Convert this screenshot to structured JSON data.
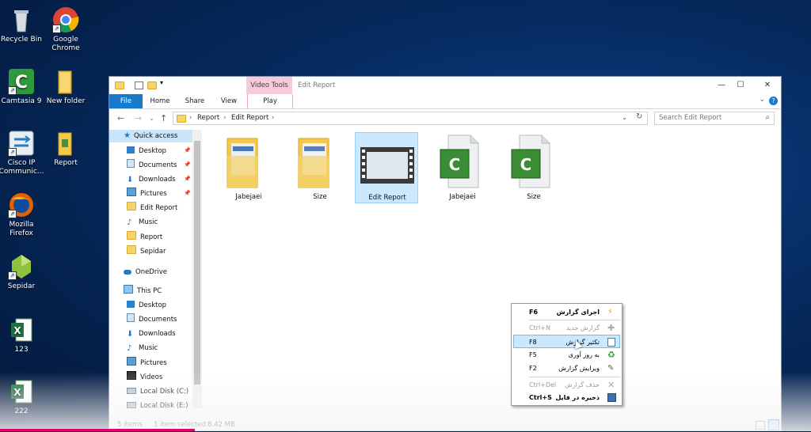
{
  "desktop": {
    "icons": [
      {
        "label": "Recycle Bin",
        "icon": "recycle-bin-icon"
      },
      {
        "label": "Google Chrome",
        "icon": "chrome-icon"
      },
      {
        "label": "Camtasia 9",
        "icon": "camtasia-icon"
      },
      {
        "label": "New folder",
        "icon": "folder-icon"
      },
      {
        "label": "Cisco IP Communic...",
        "icon": "cisco-ip-communicator-icon"
      },
      {
        "label": "Report",
        "icon": "file-icon"
      },
      {
        "label": "Mozilla Firefox",
        "icon": "firefox-icon"
      },
      {
        "label": "Sepidar",
        "icon": "sepidar-icon"
      },
      {
        "label": "123",
        "icon": "excel-icon"
      },
      {
        "label": "222",
        "icon": "excel-icon"
      }
    ]
  },
  "window": {
    "title": "Edit Report",
    "context_tab": "Video Tools",
    "ribbon_tabs": [
      "File",
      "Home",
      "Share",
      "View",
      "Play"
    ],
    "address": {
      "crumbs": [
        "Report",
        "Edit Report"
      ]
    },
    "search_placeholder": "Search Edit Report",
    "nav": {
      "quick_access": "Quick access",
      "quick_items": [
        "Desktop",
        "Documents",
        "Downloads",
        "Pictures",
        "Edit Report",
        "Music",
        "Report",
        "Sepidar"
      ],
      "onedrive": "OneDrive",
      "this_pc": "This PC",
      "pc_items": [
        "Desktop",
        "Documents",
        "Downloads",
        "Music",
        "Pictures",
        "Videos",
        "Local Disk (C:)",
        "Local Disk (E:)"
      ]
    },
    "files": [
      {
        "name": "Jabejaei",
        "type": "folder"
      },
      {
        "name": "Size",
        "type": "folder"
      },
      {
        "name": "Edit Report",
        "type": "video",
        "selected": true
      },
      {
        "name": "Jabejaei",
        "type": "camtasia"
      },
      {
        "name": "Size",
        "type": "camtasia"
      }
    ],
    "status": {
      "items": "5 items",
      "selected": "1 item selected",
      "size": "8.42 MB"
    }
  },
  "context_menu": {
    "items": [
      {
        "key": "F6",
        "label": "اجرای گزارش",
        "icon": "lightning-icon",
        "bold": true
      },
      {
        "key": "Ctrl+N",
        "label": "گزارش جدید",
        "icon": "plus-icon",
        "disabled": true
      },
      {
        "key": "F8",
        "label": "تکثیر گزارش",
        "icon": "copy-report-icon",
        "highlighted": true
      },
      {
        "key": "F5",
        "label": "به روز آوری",
        "icon": "refresh-icon"
      },
      {
        "key": "F2",
        "label": "ویرایش گزارش",
        "icon": "edit-icon"
      },
      {
        "key": "Ctrl+Del",
        "label": "حذف گزارش",
        "icon": "delete-icon",
        "disabled": true
      },
      {
        "key": "Ctrl+S",
        "label": "ذخیره در فایل",
        "icon": "save-file-icon",
        "bold": true
      }
    ]
  }
}
